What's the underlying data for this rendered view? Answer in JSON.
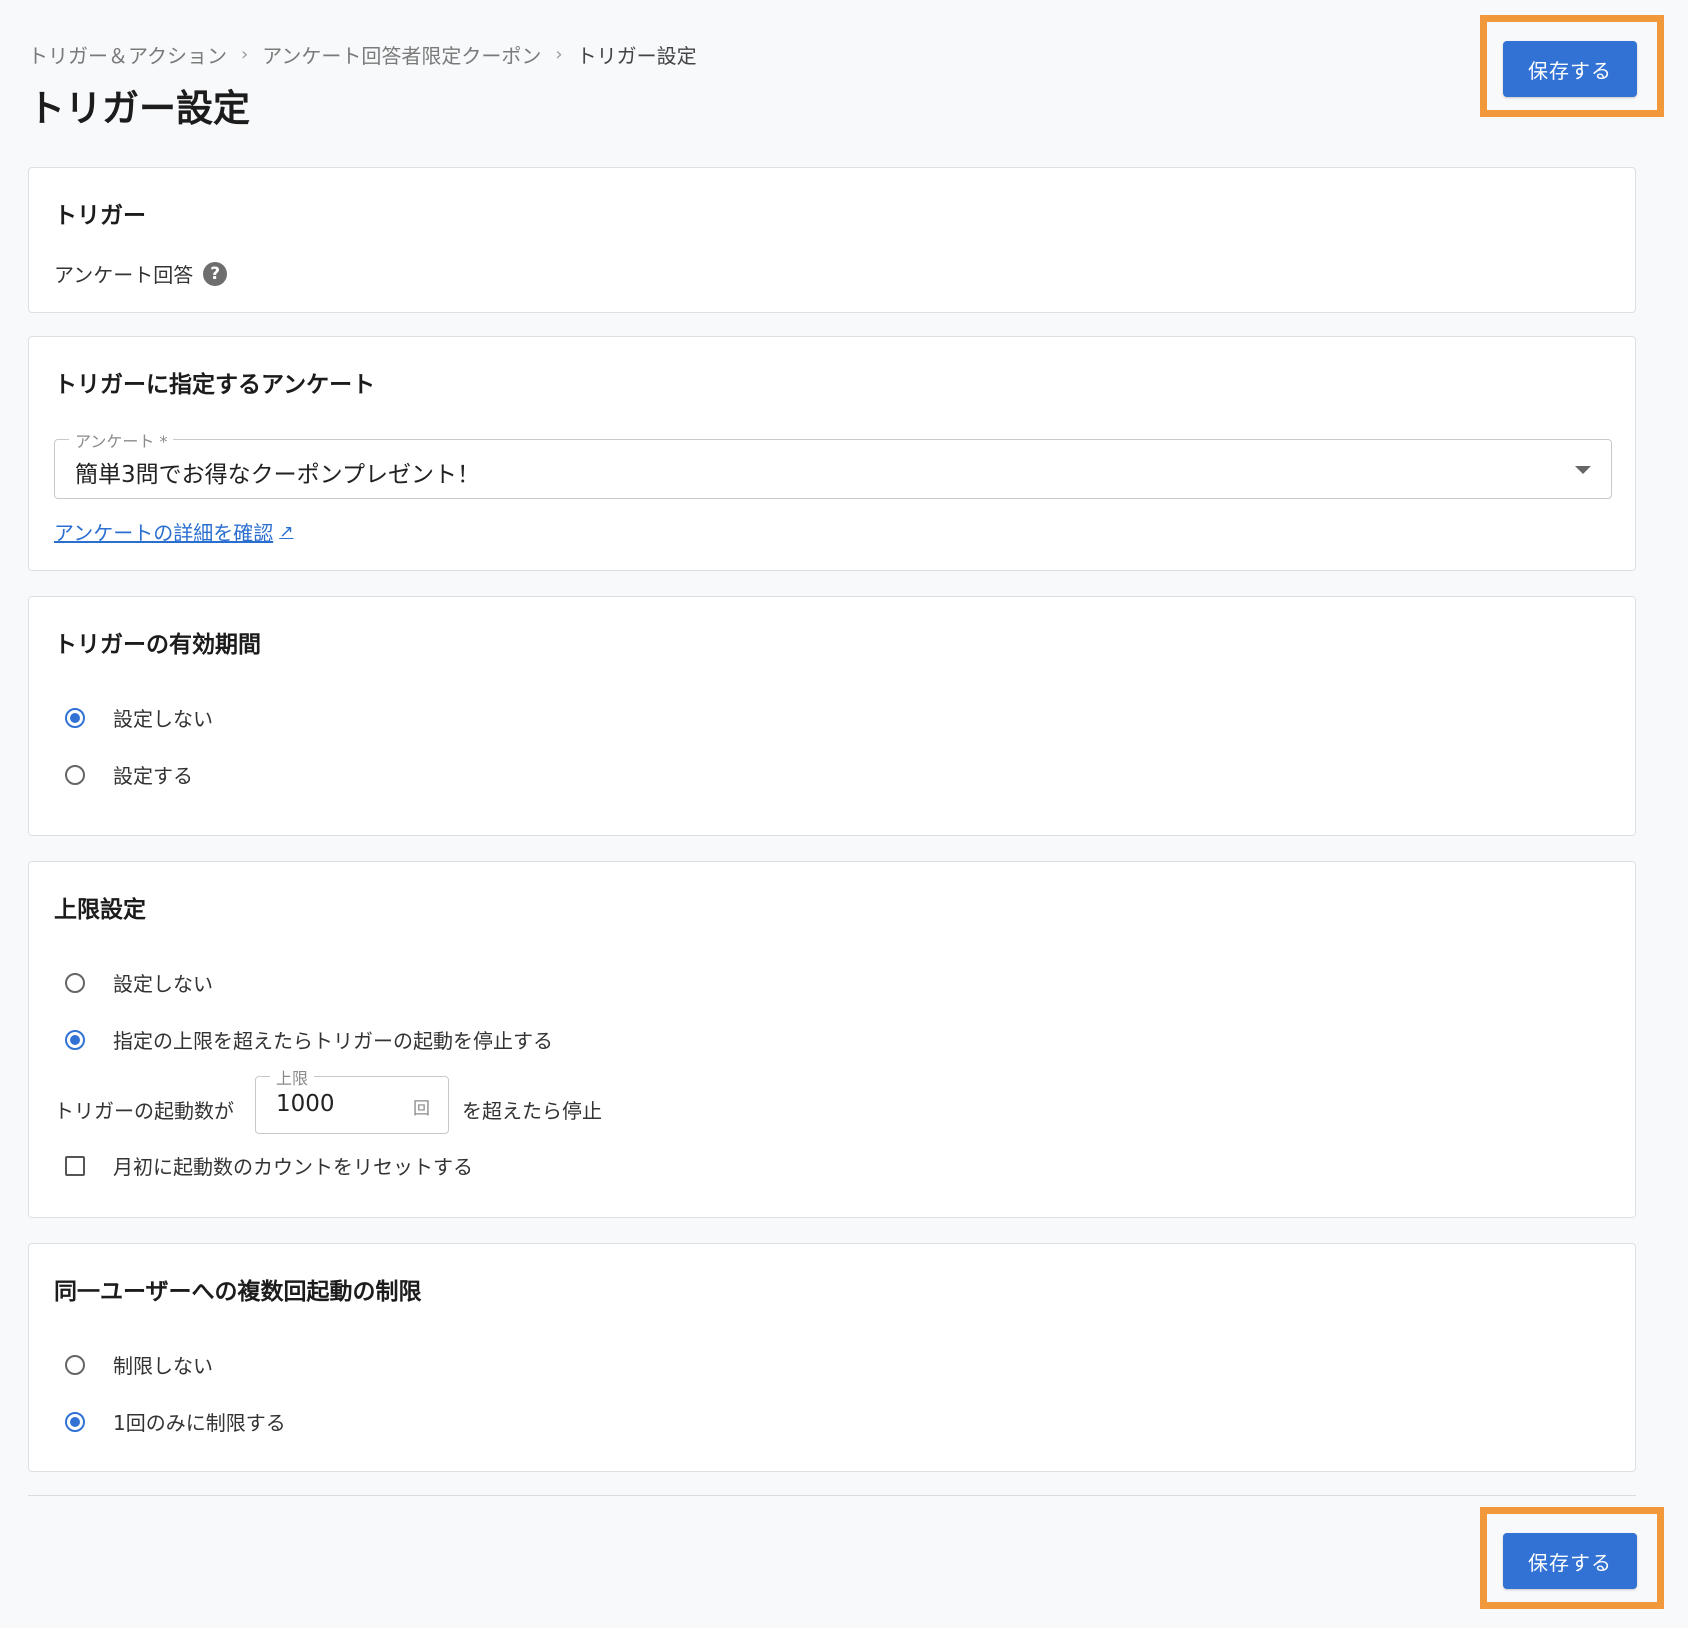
{
  "breadcrumb": {
    "items": [
      "トリガー＆アクション",
      "アンケート回答者限定クーポン",
      "トリガー設定"
    ],
    "separator": "›"
  },
  "page_title": "トリガー設定",
  "header_save_label": "保存する",
  "footer_save_label": "保存する",
  "highlight_color": "#f0983a",
  "primary_color": "#3272d4",
  "trigger_card": {
    "title": "トリガー",
    "value": "アンケート回答",
    "help_icon": "question-circle-icon"
  },
  "survey_card": {
    "title": "トリガーに指定するアンケート",
    "select_label": "アンケート *",
    "select_value": "簡単3問でお得なクーポンプレゼント！",
    "detail_link": "アンケートの詳細を確認",
    "detail_link_icon": "external-link-icon"
  },
  "period_card": {
    "title": "トリガーの有効期間",
    "options": [
      {
        "label": "設定しない",
        "checked": true
      },
      {
        "label": "設定する",
        "checked": false
      }
    ]
  },
  "limit_card": {
    "title": "上限設定",
    "options": [
      {
        "label": "設定しない",
        "checked": false
      },
      {
        "label": "指定の上限を超えたらトリガーの起動を停止する",
        "checked": true
      }
    ],
    "prefix_text": "トリガーの起動数が",
    "input_label": "上限",
    "input_value": "1000",
    "input_unit": "回",
    "suffix_text": "を超えたら停止",
    "reset_checkbox_label": "月初に起動数のカウントをリセットする",
    "reset_checked": false
  },
  "multi_card": {
    "title": "同一ユーザーへの複数回起動の制限",
    "options": [
      {
        "label": "制限しない",
        "checked": false
      },
      {
        "label": "1回のみに制限する",
        "checked": true
      }
    ]
  }
}
